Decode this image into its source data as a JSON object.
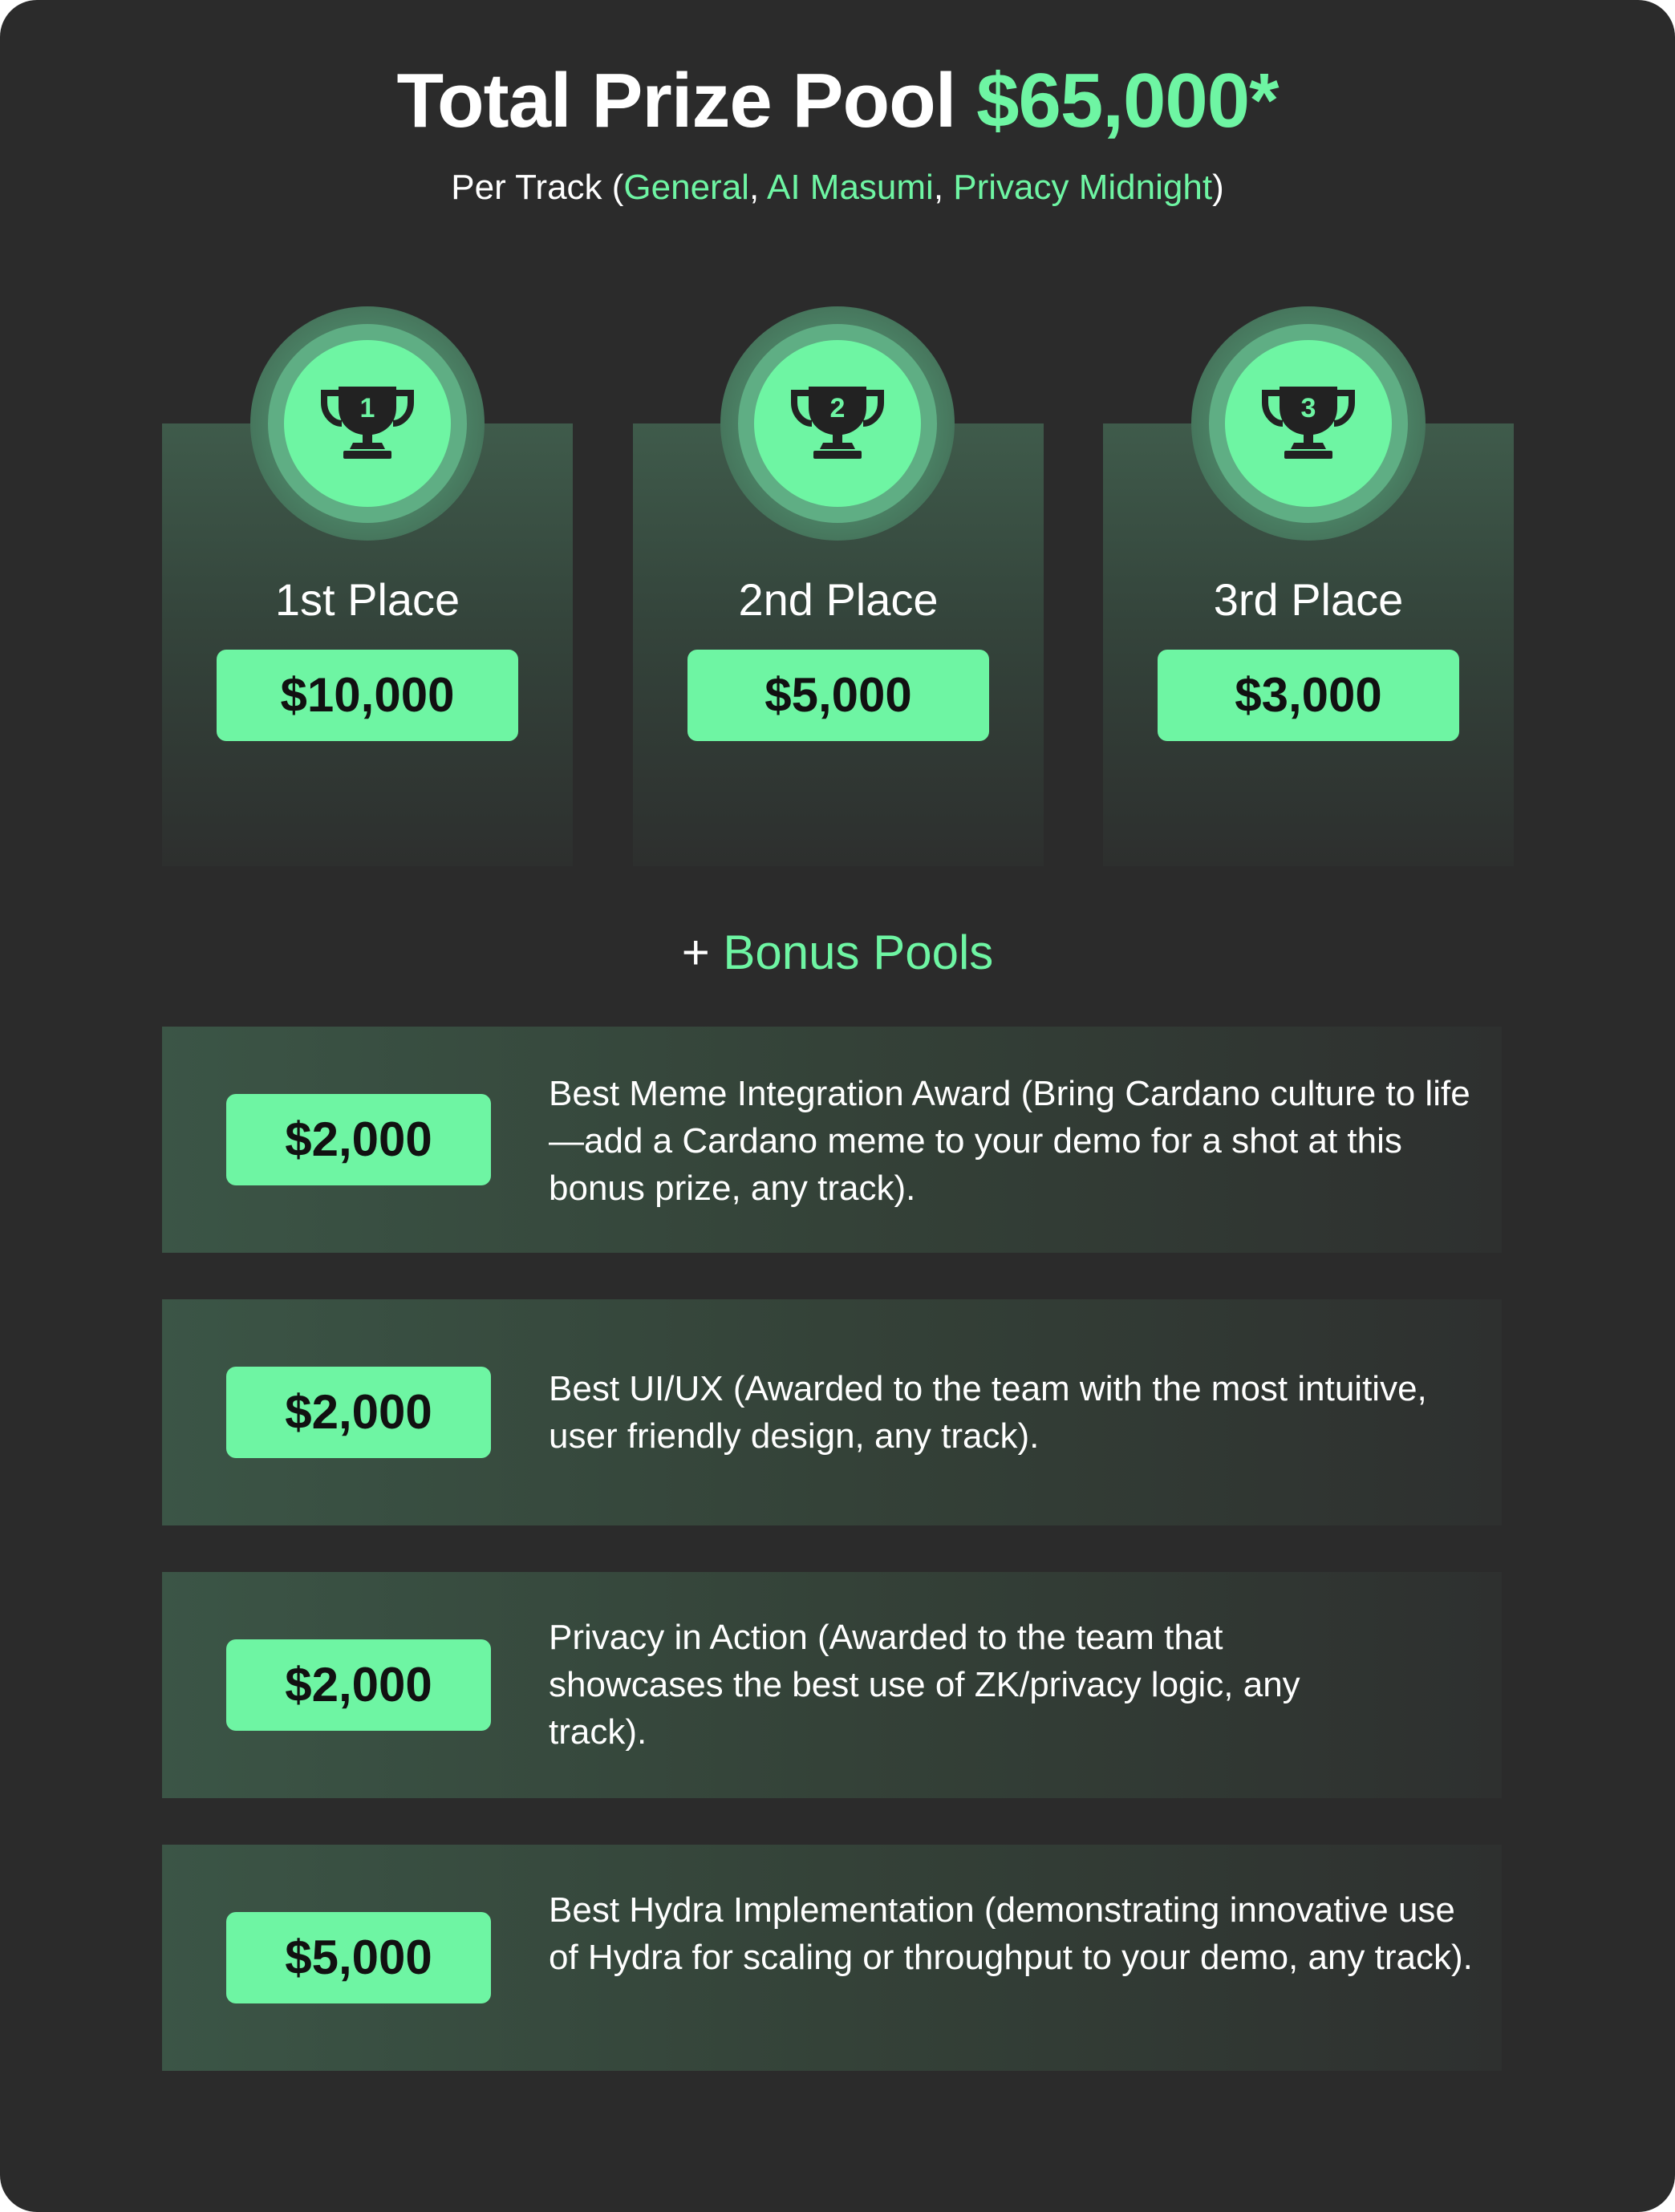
{
  "header": {
    "title_prefix": "Total Prize Pool",
    "title_amount": "$65,000*",
    "subtitle_prefix": "Per Track (",
    "tracks": [
      "General",
      "AI Masumi",
      "Privacy Midnight"
    ],
    "separator": ", ",
    "subtitle_suffix": ")"
  },
  "places": [
    {
      "rank": "1",
      "label": "1st Place",
      "amount": "$10,000",
      "icon": "trophy-icon"
    },
    {
      "rank": "2",
      "label": "2nd Place",
      "amount": "$5,000",
      "icon": "trophy-icon"
    },
    {
      "rank": "3",
      "label": "3rd Place",
      "amount": "$3,000",
      "icon": "trophy-icon"
    }
  ],
  "bonus": {
    "heading_prefix": "+ ",
    "heading": "Bonus Pools",
    "items": [
      {
        "amount": "$2,000",
        "description": "Best Meme Integration Award (Bring Cardano culture to life—add a Cardano meme to your demo for a shot at this bonus prize, any track)."
      },
      {
        "amount": "$2,000",
        "description": "Best UI/UX (Awarded to the team with the most intuitive, user friendly design, any track)."
      },
      {
        "amount": "$2,000",
        "description": "Privacy in Action (Awarded to the team that showcases the best use of ZK/privacy logic, any track)."
      },
      {
        "amount": "$5,000",
        "description": "Best Hydra Implementation (demonstrating innovative use of Hydra for scaling or throughput to your demo, any track)."
      }
    ]
  },
  "colors": {
    "background": "#2b2b2b",
    "accent": "#6ef5a3",
    "text": "#ffffff",
    "amount_text": "#111111"
  }
}
